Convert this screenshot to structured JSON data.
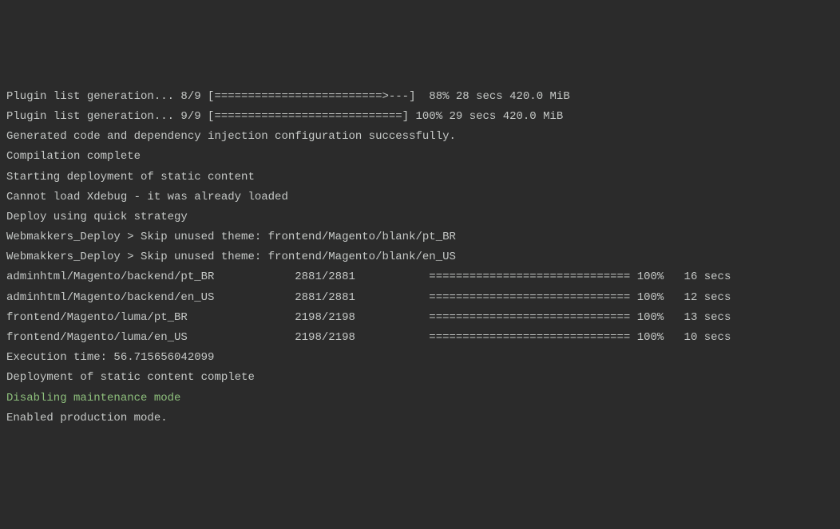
{
  "lines": [
    {
      "text": "Plugin list generation... 8/9 [=========================>---]  88% 28 secs 420.0 MiB",
      "class": ""
    },
    {
      "text": "Plugin list generation... 9/9 [============================] 100% 29 secs 420.0 MiB",
      "class": ""
    },
    {
      "text": "Generated code and dependency injection configuration successfully.",
      "class": ""
    },
    {
      "text": "Compilation complete",
      "class": ""
    },
    {
      "text": "Starting deployment of static content",
      "class": ""
    },
    {
      "text": "Cannot load Xdebug - it was already loaded",
      "class": ""
    },
    {
      "text": "",
      "class": ""
    },
    {
      "text": "Deploy using quick strategy",
      "class": ""
    },
    {
      "text": "Webmakkers_Deploy > Skip unused theme: frontend/Magento/blank/pt_BR",
      "class": ""
    },
    {
      "text": "Webmakkers_Deploy > Skip unused theme: frontend/Magento/blank/en_US",
      "class": ""
    },
    {
      "text": "adminhtml/Magento/backend/pt_BR            2881/2881           ============================== 100%   16 secs",
      "class": ""
    },
    {
      "text": "adminhtml/Magento/backend/en_US            2881/2881           ============================== 100%   12 secs",
      "class": ""
    },
    {
      "text": "frontend/Magento/luma/pt_BR                2198/2198           ============================== 100%   13 secs",
      "class": ""
    },
    {
      "text": "frontend/Magento/luma/en_US                2198/2198           ============================== 100%   10 secs",
      "class": ""
    },
    {
      "text": "",
      "class": ""
    },
    {
      "text": "Execution time: 56.715656042099",
      "class": ""
    },
    {
      "text": "Deployment of static content complete",
      "class": ""
    },
    {
      "text": "Disabling maintenance mode",
      "class": "green"
    },
    {
      "text": "Enabled production mode.",
      "class": ""
    }
  ]
}
